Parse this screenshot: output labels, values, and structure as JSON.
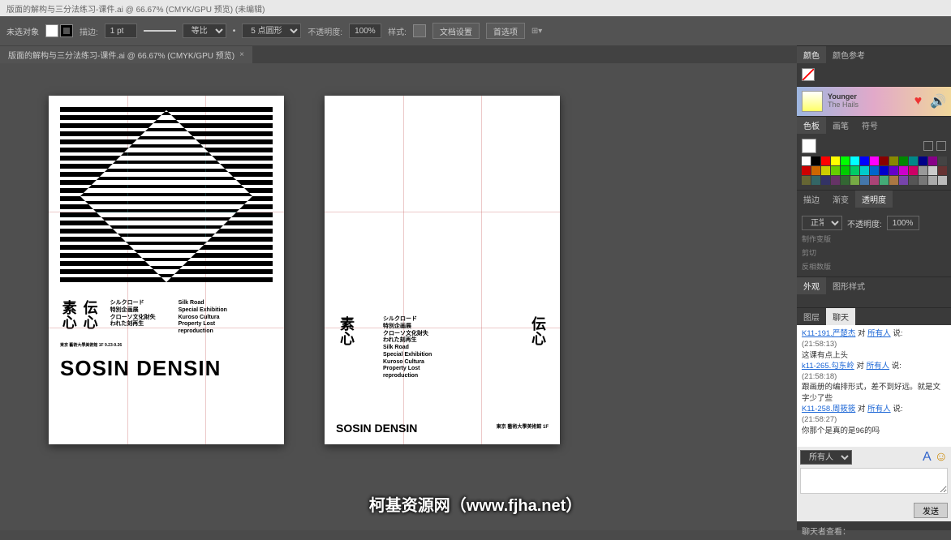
{
  "window_title": "版面的解构与三分法练习-课件.ai @ 66.67% (CMYK/GPU 预览) (未编辑)",
  "ctrl": {
    "target_label": "未选对象",
    "stroke_label": "描边:",
    "stroke_value": "1 pt",
    "stroke_style": "等比",
    "point_label": "5 点圆形",
    "opacity_label": "不透明度:",
    "opacity_value": "100%",
    "style_label": "样式:",
    "docsetup": "文档设置",
    "prefs": "首选项"
  },
  "doc_tab": "版面的解构与三分法练习-课件.ai @ 66.67% (CMYK/GPU 预览)",
  "poster": {
    "kanji1": "素心",
    "kanji2": "伝心",
    "jp1": "シルクロード",
    "jp2": "特別企画展",
    "jp3": "クローソ文化財失",
    "jp4": "われた刻再生",
    "en1": "Silk Road",
    "en2": "Special Exhibition",
    "en3": "Kuroso Cultura",
    "en4": "Property Lost",
    "en5": "reproduction",
    "tiny": "東京 藝術大學美術館 1F  9.23-9.26",
    "title": "SOSIN DENSIN",
    "ab2_foot_sm": "東京 藝術大學美術館 1F"
  },
  "panels": {
    "color_tab": "颜色",
    "color_ref_tab": "颜色参考",
    "swatch_tab": "色板",
    "brush_tab": "画笔",
    "symbol_tab": "符号",
    "stroke_tab": "描边",
    "grad_tab": "渐变",
    "opacity_tab": "透明度",
    "opacity_mode": "正常",
    "opacity_label2": "不透明度:",
    "opacity_val2": "100%",
    "appear_tab": "外观",
    "gfx_tab": "图形样式",
    "appear_sub1": "制作变版",
    "appear_sub2": "剪切",
    "appear_sub3": "反相数版",
    "layers_tab": "图层",
    "chat_tab": "聊天",
    "footer": "聊天者查看："
  },
  "media": {
    "title": "Younger",
    "artist": "The Hails"
  },
  "chat": {
    "l1_user": "K11-191.严楚杰",
    "at": "对",
    "all": "所有人",
    "say": "说:",
    "l1_time": "(21:58:13)",
    "l1_msg": "这课有点上头",
    "l2_user": "k11-265.勾东岭",
    "l2_time": "(21:58:18)",
    "l2_msg": "跟画册的编排形式，差不到好远。就是文字少了些",
    "l3_user": "K11-258.周筱筱",
    "l3_time": "(21:58:27)",
    "l3_msg": "你那个是真的是96的吗",
    "select": "所有人",
    "send": "发送"
  },
  "watermark": "柯基资源网（www.fjha.net）"
}
